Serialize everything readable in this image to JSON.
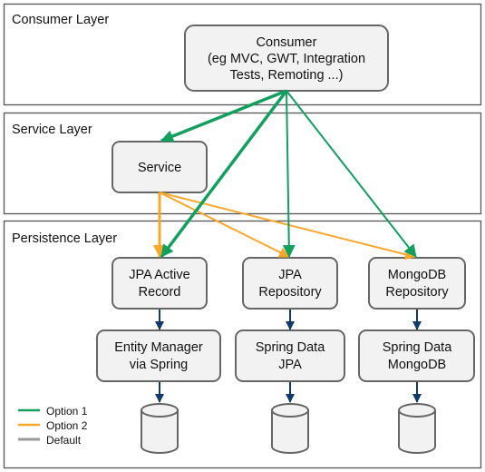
{
  "colors": {
    "option1": "#13a05f",
    "option2": "#f9a72b",
    "default": "#999999",
    "dependency": "#0f3b66"
  },
  "layers": {
    "consumer": "Consumer Layer",
    "service": "Service Layer",
    "persistence": "Persistence Layer"
  },
  "nodes": {
    "consumer": [
      "Consumer",
      "(eg MVC, GWT, Integration",
      "Tests, Remoting ...)"
    ],
    "service": [
      "Service"
    ],
    "jpa_active_record": [
      "JPA Active",
      "Record"
    ],
    "jpa_repository": [
      "JPA",
      "Repository"
    ],
    "mongodb_repository": [
      "MongoDB",
      "Repository"
    ],
    "entity_manager": [
      "Entity Manager",
      "via Spring"
    ],
    "spring_data_jpa": [
      "Spring Data",
      "JPA"
    ],
    "spring_data_mongodb": [
      "Spring Data",
      "MongoDB"
    ]
  },
  "legend": [
    {
      "label": "Option 1",
      "color": "#13a05f"
    },
    {
      "label": "Option 2",
      "color": "#f9a72b"
    },
    {
      "label": "Default",
      "color": "#999999"
    }
  ]
}
